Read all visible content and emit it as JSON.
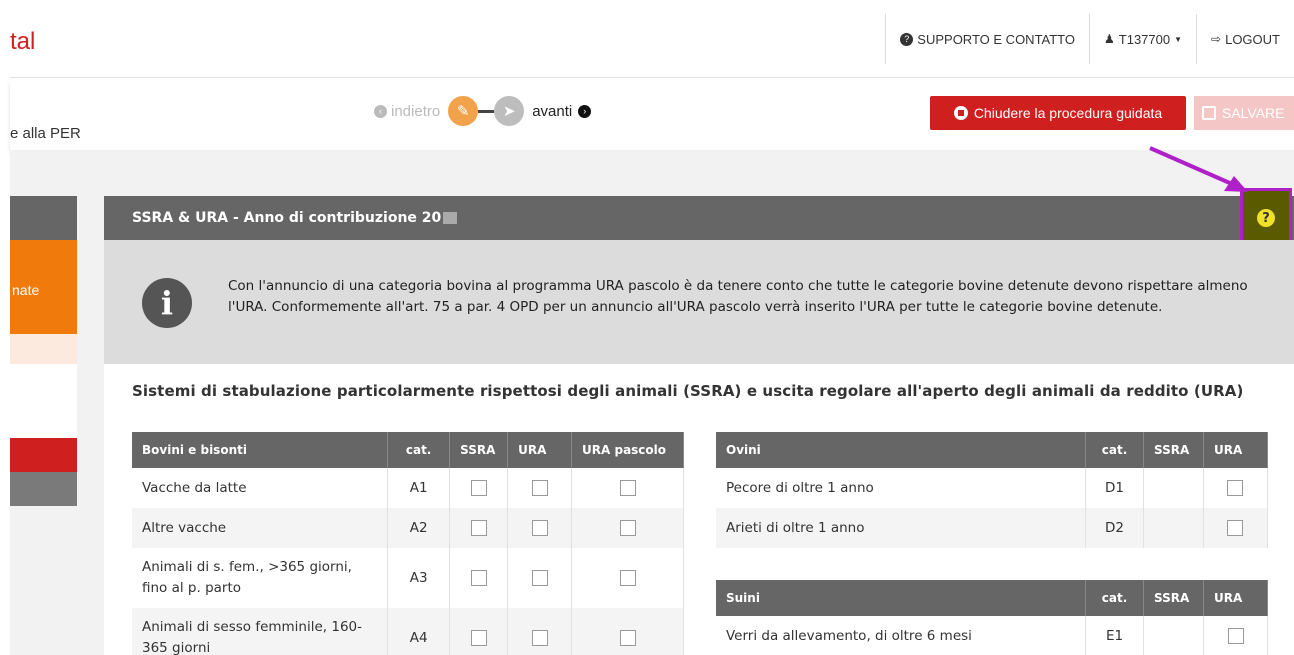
{
  "brand": "tal",
  "topnav": {
    "support": "SUPPORTO E CONTATTO",
    "user": "T137700",
    "logout": "LOGOUT"
  },
  "wizard": {
    "breadcrumb": "e alla PER",
    "back": "indietro",
    "next": "avanti",
    "close_label": "Chiudere la procedura guidata",
    "save_label": "SALVARE"
  },
  "sidebar": {
    "active_label": "nate"
  },
  "panel": {
    "title": "SSRA & URA - Anno di contribuzione 20",
    "info": "Con l'annuncio di una categoria bovina al programma URA pascolo è da tenere conto che tutte le categorie bovine detenute devono rispettare almeno l'URA. Conformemente all'art. 75 a par. 4 OPD per un annuncio all'URA pascolo verrà inserito l'URA per tutte le categorie bovine detenute.",
    "section_title": "Sistemi di stabulazione particolarmente rispettosi degli animali (SSRA) e uscita regolare all'aperto degli animali da reddito (URA)"
  },
  "bovini": {
    "headers": [
      "Bovini e bisonti",
      "cat.",
      "SSRA",
      "URA",
      "URA pascolo"
    ],
    "rows": [
      {
        "name": "Vacche da latte",
        "cat": "A1"
      },
      {
        "name": "Altre vacche",
        "cat": "A2"
      },
      {
        "name": "Animali di s. fem., >365 giorni, fino al p. parto",
        "cat": "A3"
      },
      {
        "name": "Animali di sesso femminile, 160-365 giorni",
        "cat": "A4"
      }
    ]
  },
  "ovini": {
    "headers": [
      "Ovini",
      "cat.",
      "SSRA",
      "URA"
    ],
    "rows": [
      {
        "name": "Pecore di oltre 1 anno",
        "cat": "D1"
      },
      {
        "name": "Arieti di oltre 1 anno",
        "cat": "D2"
      }
    ]
  },
  "suini": {
    "headers": [
      "Suini",
      "cat.",
      "SSRA",
      "URA"
    ],
    "rows": [
      {
        "name": "Verri da allevamento, di oltre 6 mesi",
        "cat": "E1"
      }
    ]
  },
  "colors": {
    "accent_red": "#d01f1f",
    "accent_orange": "#f07a0c",
    "annotation": "#b020c8"
  }
}
